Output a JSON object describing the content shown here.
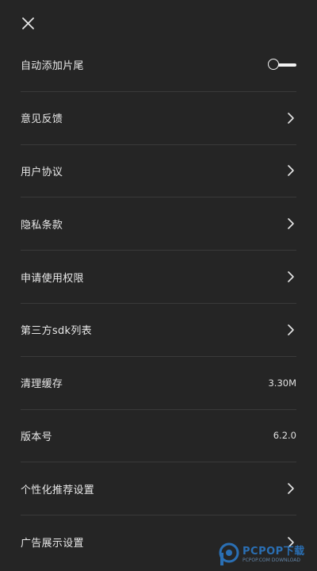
{
  "header": {
    "close_icon": "close-icon"
  },
  "settings": [
    {
      "label": "自动添加片尾",
      "control": "toggle",
      "toggle_on": false
    },
    {
      "label": "意见反馈",
      "control": "chevron"
    },
    {
      "label": "用户协议",
      "control": "chevron"
    },
    {
      "label": "隐私条款",
      "control": "chevron"
    },
    {
      "label": "申请使用权限",
      "control": "chevron"
    },
    {
      "label": "第三方sdk列表",
      "control": "chevron"
    },
    {
      "label": "清理缓存",
      "control": "value",
      "value": "3.30M"
    },
    {
      "label": "版本号",
      "control": "value",
      "value": "6.2.0"
    },
    {
      "label": "个性化推荐设置",
      "control": "chevron"
    },
    {
      "label": "广告展示设置",
      "control": "chevron"
    }
  ],
  "watermark": {
    "text": "PCPOP下载",
    "subtext": "PCPOP.COM DOWNLOAD"
  },
  "colors": {
    "background": "#252525",
    "text": "#e8e8e8",
    "divider": "#3a3a3a",
    "watermark": "#2b78c4"
  }
}
